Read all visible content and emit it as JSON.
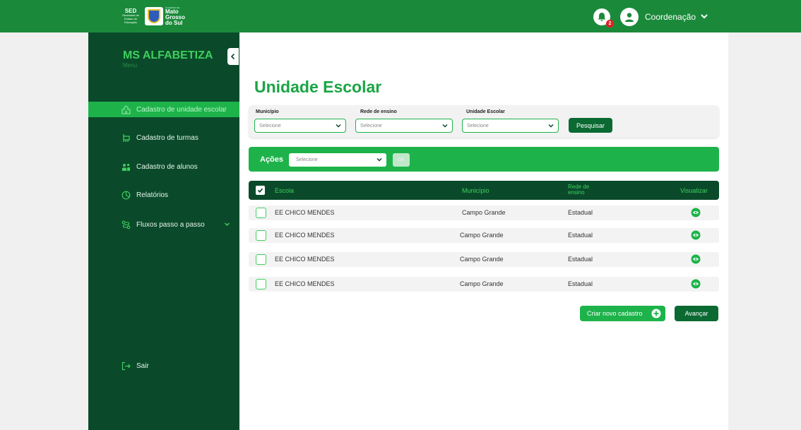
{
  "header": {
    "logo_sed": "SED",
    "logo_sed_sub": "Secretaria de Estado de Educação",
    "logo_ms": "Mato Grosso do Sul",
    "logo_ms_top": "GOVERNO DE",
    "notification_count": "2",
    "user_name": "Coordenação"
  },
  "sidebar": {
    "brand": "MS ALFABETIZA",
    "brand_sub": "Menu",
    "items": [
      {
        "label": "Cadastro de unidade escolar",
        "icon": "school-icon",
        "active": true
      },
      {
        "label": "Cadastro de turmas",
        "icon": "classroom-icon",
        "active": false
      },
      {
        "label": "Cadastro de alunos",
        "icon": "students-icon",
        "active": false
      },
      {
        "label": "Relatórios",
        "icon": "report-icon",
        "active": false
      },
      {
        "label": "Fluxos passo a passo",
        "icon": "flow-icon",
        "active": false,
        "expandable": true
      }
    ],
    "logout": "Sair"
  },
  "page": {
    "title": "Unidade Escolar"
  },
  "filters": {
    "municipio_label": "Município",
    "municipio_placeholder": "Selecione",
    "rede_label": "Rede de ensino",
    "rede_placeholder": "Selecione",
    "unidade_label": "Unidade Escolar",
    "unidade_placeholder": "Selecione",
    "search_button": "Pesquisar"
  },
  "actions": {
    "label": "Ações",
    "placeholder": "Selecione",
    "ok_button": "OK"
  },
  "table": {
    "headers": {
      "escola": "Escola",
      "municipio": "Município",
      "rede_line1": "Rede de",
      "rede_line2": "ensino",
      "visualizar": "Visualizar"
    },
    "rows": [
      {
        "escola": "EE CHICO MENDES",
        "municipio": "Campo Grande",
        "rede": "Estadual"
      },
      {
        "escola": "EE CHICO MENDES",
        "municipio": "Campo Grande",
        "rede": "Estadual"
      },
      {
        "escola": "EE CHICO MENDES",
        "municipio": "Campo Grande",
        "rede": "Estadual"
      },
      {
        "escola": "EE CHICO MENDES",
        "municipio": "Campo Grande",
        "rede": "Estadual"
      }
    ]
  },
  "footer_buttons": {
    "criar": "Criar novo cadastro",
    "avancar": "Avançar"
  },
  "colors": {
    "topbar": "#1a8a3a",
    "sidebar": "#0a4a2a",
    "accent": "#1db34a",
    "dark_button": "#0a6a32"
  }
}
